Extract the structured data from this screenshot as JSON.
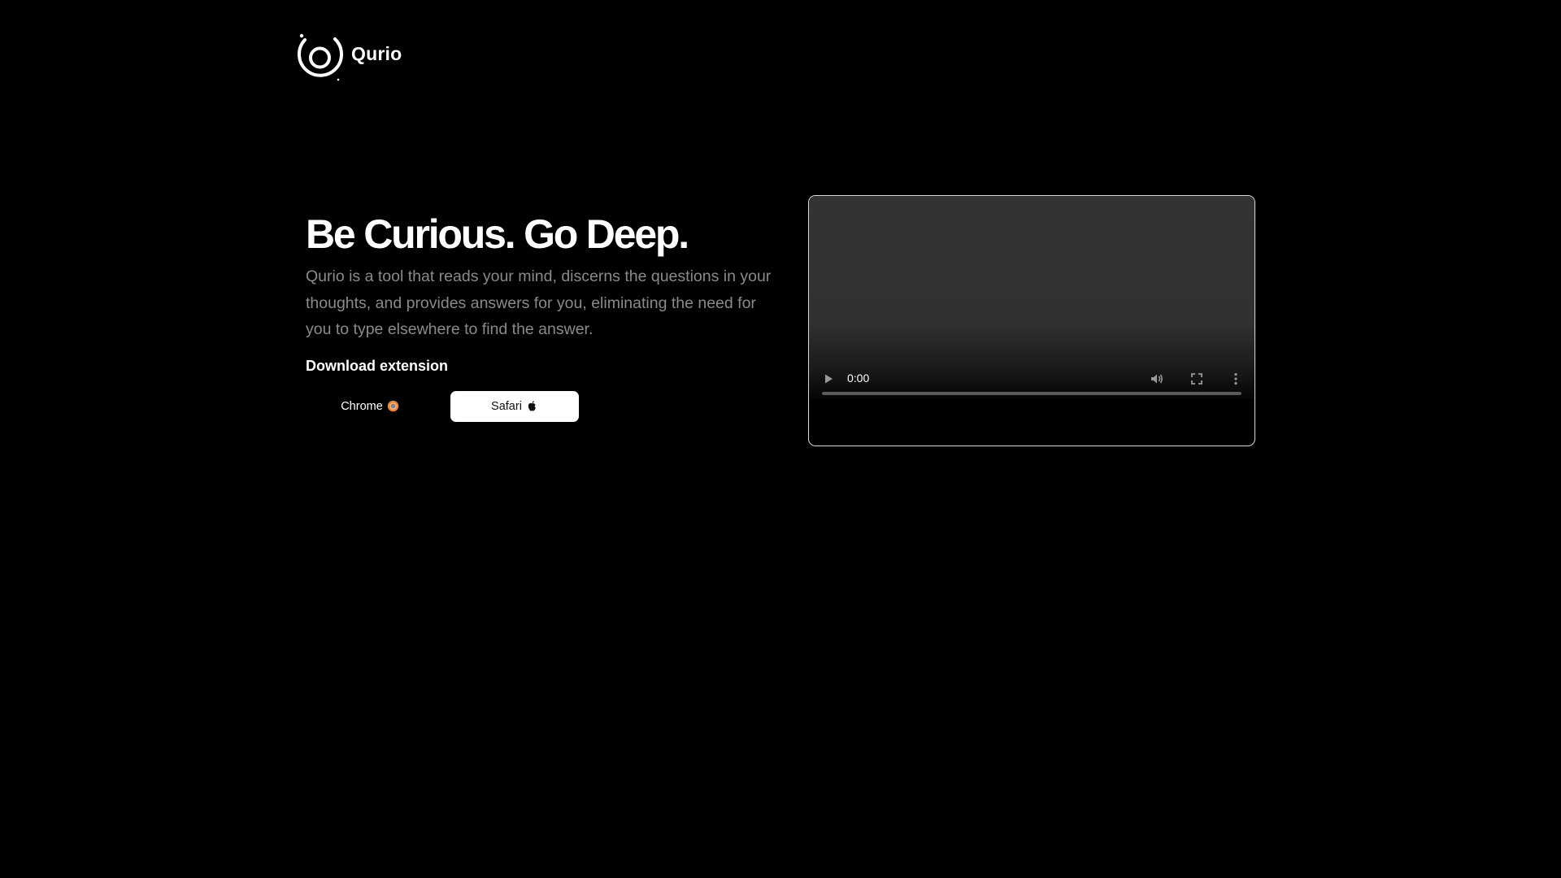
{
  "brand": {
    "name": "Qurio",
    "logo_icon": "orbit-ring-icon"
  },
  "hero": {
    "title": "Be Curious. Go Deep.",
    "description": "Qurio is a tool that reads your mind, discerns the questions in your thoughts, and provides answers for you, eliminating the need for you to type elsewhere to find the answer.",
    "download_label": "Download extension",
    "buttons": [
      {
        "label": "Chrome",
        "icon": "chrome-icon"
      },
      {
        "label": "Safari",
        "icon": "apple-icon"
      }
    ]
  },
  "video": {
    "time": "0:00",
    "progress": 0,
    "controls": [
      "play-icon",
      "volume-icon",
      "fullscreen-icon",
      "more-vertical-icon"
    ]
  },
  "colors": {
    "background": "#000000",
    "text": "#ffffff",
    "muted_text": "#8a8a8a",
    "chrome_orange": "#f0822a",
    "video_border": "#d9d9d9"
  }
}
